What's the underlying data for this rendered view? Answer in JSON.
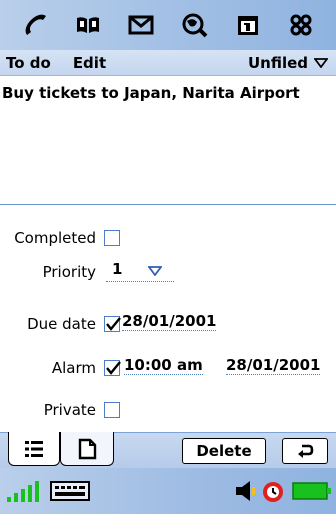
{
  "launcher": {
    "icons": [
      "phone-icon",
      "address-book-icon",
      "messaging-icon",
      "web-icon",
      "calendar-icon",
      "applications-icon"
    ]
  },
  "menubar": {
    "todo_label": "To do",
    "edit_label": "Edit",
    "category_value": "Unfiled"
  },
  "task": {
    "description": "Buy tickets to Japan, Narita Airport"
  },
  "details": {
    "completed_label": "Completed",
    "completed_checked": false,
    "priority_label": "Priority",
    "priority_value": "1",
    "due_date_label": "Due date",
    "due_date_checked": true,
    "due_date_value": "28/01/2001",
    "alarm_label": "Alarm",
    "alarm_checked": true,
    "alarm_time": "10:00 am",
    "alarm_date": "28/01/2001",
    "private_label": "Private",
    "private_checked": false
  },
  "cmdbar": {
    "delete_label": "Delete",
    "tab_details_icon": "details-list-icon",
    "tab_note_icon": "note-icon",
    "back_icon": "return-arrow-icon"
  },
  "status": {
    "icons": [
      "signal-strength-icon",
      "keyboard-icon",
      "volume-icon",
      "clock-alarm-icon",
      "battery-icon"
    ]
  },
  "colors": {
    "accent": "#4f7ec8",
    "bar_blue": "#a7c3e6",
    "battery_green": "#19c11e",
    "alarm_red": "#e02020"
  }
}
